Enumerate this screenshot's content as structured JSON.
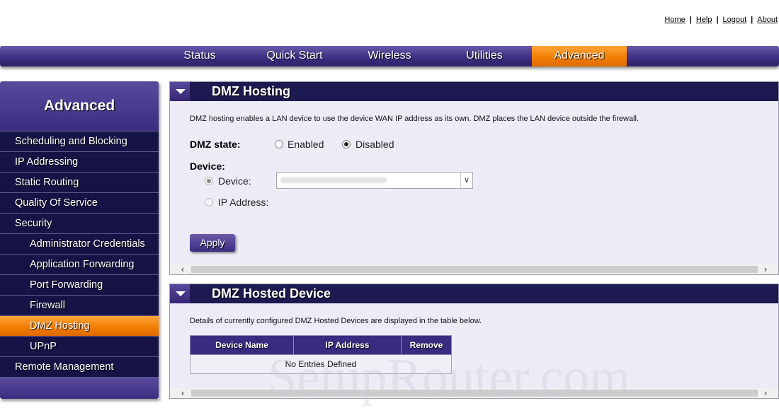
{
  "top_links": [
    "Home",
    "Help",
    "Logout",
    "About"
  ],
  "nav": {
    "tabs": [
      "Status",
      "Quick Start",
      "Wireless",
      "Utilities",
      "Advanced"
    ],
    "active": "Advanced"
  },
  "sidebar": {
    "title": "Advanced",
    "items": [
      {
        "label": "Scheduling and Blocking"
      },
      {
        "label": "IP Addressing"
      },
      {
        "label": "Static Routing"
      },
      {
        "label": "Quality Of Service"
      },
      {
        "label": "Security"
      },
      {
        "label": "Administrator Credentials"
      },
      {
        "label": "Application Forwarding"
      },
      {
        "label": "Port Forwarding"
      },
      {
        "label": "Firewall"
      },
      {
        "label": "DMZ Hosting"
      },
      {
        "label": "UPnP"
      },
      {
        "label": "Remote Management"
      }
    ],
    "active": "DMZ Hosting"
  },
  "dmz": {
    "title": "DMZ Hosting",
    "description": "DMZ hosting enables a LAN device to use the device WAN IP address as its own. DMZ places the LAN device outside the firewall.",
    "state_label": "DMZ state:",
    "enabled_label": "Enabled",
    "disabled_label": "Disabled",
    "state_value": "Disabled",
    "device_label": "Device:",
    "device_option_label": "Device:",
    "ip_option_label": "IP Address:",
    "apply_label": "Apply"
  },
  "hosted": {
    "title": "DMZ Hosted Device",
    "description": "Details of currently configured DMZ Hosted Devices are displayed in the table below.",
    "columns": [
      "Device Name",
      "IP Address",
      "Remove"
    ],
    "empty_text": "No Entries Defined"
  },
  "watermark": "SetupRouter.com",
  "colors": {
    "nav_purple": "#3f2f85",
    "active_orange": "#f07b00",
    "sidebar_dark": "#161346",
    "panel_bg": "#edecf6"
  }
}
